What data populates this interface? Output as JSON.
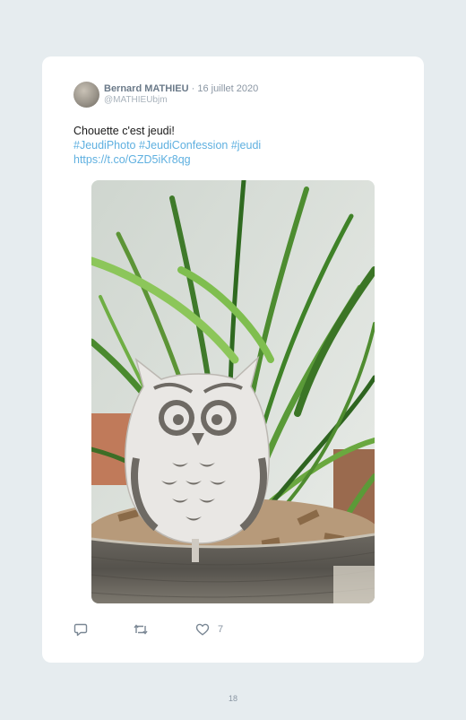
{
  "tweet": {
    "author_name": "Bernard MATHIEU",
    "date": "16 juillet 2020",
    "handle": "@MATHIEUbjm",
    "text_line1": "Chouette c'est jeudi!",
    "hashtags": "#JeudiPhoto #JeudiConfession #jeudi",
    "link": "https://t.co/GZD5iKr8qg",
    "like_count": "7"
  },
  "icons": {
    "reply": "reply-icon",
    "retweet": "retweet-icon",
    "like": "heart-icon"
  },
  "page_number": "18"
}
